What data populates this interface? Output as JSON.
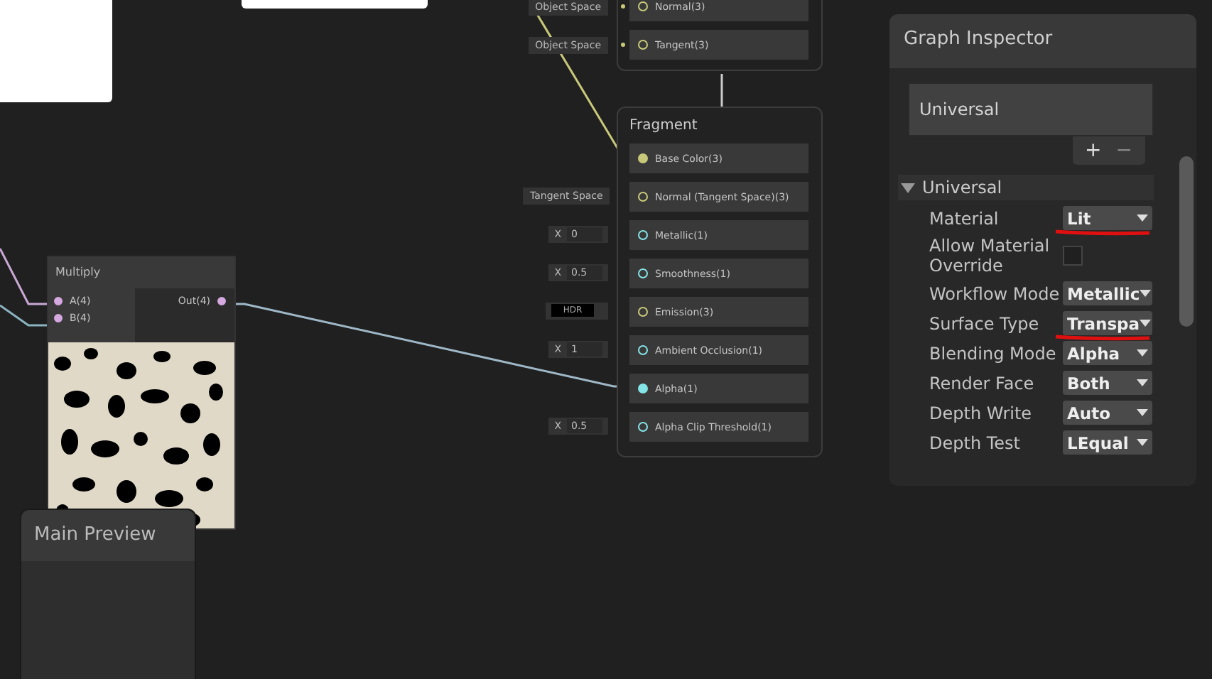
{
  "vertex_block": {
    "slots": [
      {
        "label": "Normal(3)",
        "connected": false,
        "color": "#c8c87a",
        "input": {
          "kind": "space",
          "value": "Object Space"
        }
      },
      {
        "label": "Tangent(3)",
        "connected": false,
        "color": "#c8c87a",
        "input": {
          "kind": "space",
          "value": "Object Space"
        }
      }
    ]
  },
  "fragment": {
    "title": "Fragment",
    "slots": [
      {
        "label": "Base Color(3)",
        "connected": true,
        "color": "#c8c87a"
      },
      {
        "label": "Normal (Tangent Space)(3)",
        "connected": false,
        "color": "#c8c87a",
        "input": {
          "kind": "space",
          "value": "Tangent Space"
        }
      },
      {
        "label": "Metallic(1)",
        "connected": false,
        "color": "#84e4e7",
        "input": {
          "kind": "float",
          "axis": "X",
          "value": "0"
        }
      },
      {
        "label": "Smoothness(1)",
        "connected": false,
        "color": "#84e4e7",
        "input": {
          "kind": "float",
          "axis": "X",
          "value": "0.5"
        }
      },
      {
        "label": "Emission(3)",
        "connected": false,
        "color": "#c8c87a",
        "input": {
          "kind": "color",
          "value": "HDR"
        }
      },
      {
        "label": "Ambient Occlusion(1)",
        "connected": false,
        "color": "#84e4e7",
        "input": {
          "kind": "float",
          "axis": "X",
          "value": "1"
        }
      },
      {
        "label": "Alpha(1)",
        "connected": true,
        "color": "#84e4e7"
      },
      {
        "label": "Alpha Clip Threshold(1)",
        "connected": false,
        "color": "#84e4e7",
        "input": {
          "kind": "float",
          "axis": "X",
          "value": "0.5"
        }
      }
    ]
  },
  "multiply": {
    "title": "Multiply",
    "inputs": [
      {
        "label": "A(4)",
        "connected": true
      },
      {
        "label": "B(4)",
        "connected": true
      }
    ],
    "outputs": [
      {
        "label": "Out(4)",
        "connected": true
      }
    ]
  },
  "main_preview": {
    "title": "Main Preview"
  },
  "inspector": {
    "title": "Graph Inspector",
    "targets": [
      {
        "label": "Universal"
      }
    ],
    "add_button": "+",
    "remove_button": "−",
    "section": {
      "title": "Universal",
      "expanded": true,
      "properties": [
        {
          "kind": "dropdown",
          "label": "Material",
          "value": "Lit",
          "annotated": true
        },
        {
          "kind": "checkbox",
          "label": "Allow Material Override",
          "checked": false
        },
        {
          "kind": "dropdown",
          "label": "Workflow Mode",
          "value": "Metallic"
        },
        {
          "kind": "dropdown",
          "label": "Surface Type",
          "value": "Transpa",
          "annotated": true
        },
        {
          "kind": "dropdown",
          "label": "Blending Mode",
          "value": "Alpha"
        },
        {
          "kind": "dropdown",
          "label": "Render Face",
          "value": "Both"
        },
        {
          "kind": "dropdown",
          "label": "Depth Write",
          "value": "Auto"
        },
        {
          "kind": "dropdown",
          "label": "Depth Test",
          "value": "LEqual"
        }
      ]
    }
  }
}
